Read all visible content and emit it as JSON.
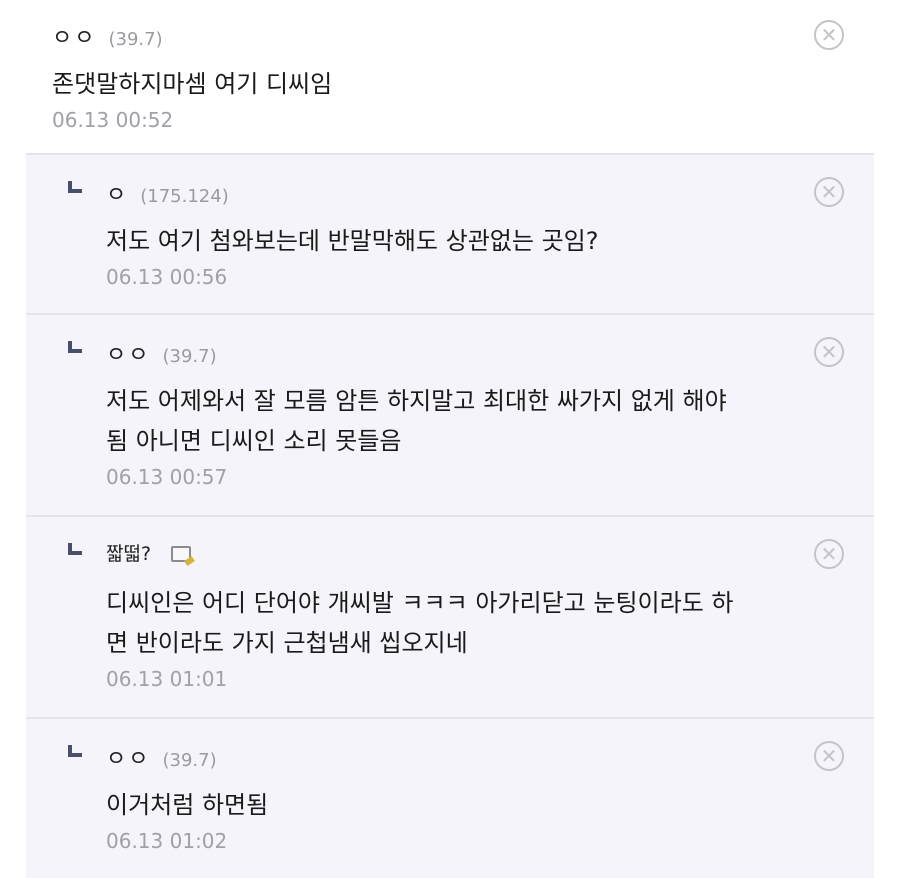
{
  "comments": [
    {
      "nickname": "ㅇㅇ",
      "ip": "(39.7)",
      "text": "존댓말하지마셈 여기 디씨임",
      "date": "06.13 00:52",
      "delete_icon": "close-circle-icon"
    },
    {
      "nickname": "ㅇ",
      "ip": "(175.124)",
      "text": "저도 여기 첨와보는데 반말막해도 상관없는 곳임?",
      "date": "06.13 00:56",
      "delete_icon": "close-circle-icon"
    },
    {
      "nickname": "ㅇㅇ",
      "ip": "(39.7)",
      "text": "저도 어제와서 잘 모름 암튼 하지말고 최대한 싸가지 없게 해야\n됨 아니면 디씨인 소리 못들음",
      "date": "06.13 00:57",
      "delete_icon": "close-circle-icon"
    },
    {
      "nickname": "짧떫?",
      "ip": "",
      "text": "디씨인은 어디 단어야 개씨발 ㅋㅋㅋ 아가리닫고 눈팅이라도 하\n면 반이라도 가지 근첩냄새 씹오지네",
      "date": "06.13 01:01",
      "memo_icon": "memo-icon",
      "delete_icon": "close-circle-icon"
    },
    {
      "nickname": "ㅇㅇ",
      "ip": "(39.7)",
      "text": "이거처럼 하면됨",
      "date": "06.13 01:02",
      "delete_icon": "close-circle-icon"
    }
  ],
  "colors": {
    "reply_background": "#f4f4fa",
    "divider": "#e4e5ec",
    "meta_gray": "#9a9aa2",
    "reply_arrow": "#4a4f6a"
  }
}
